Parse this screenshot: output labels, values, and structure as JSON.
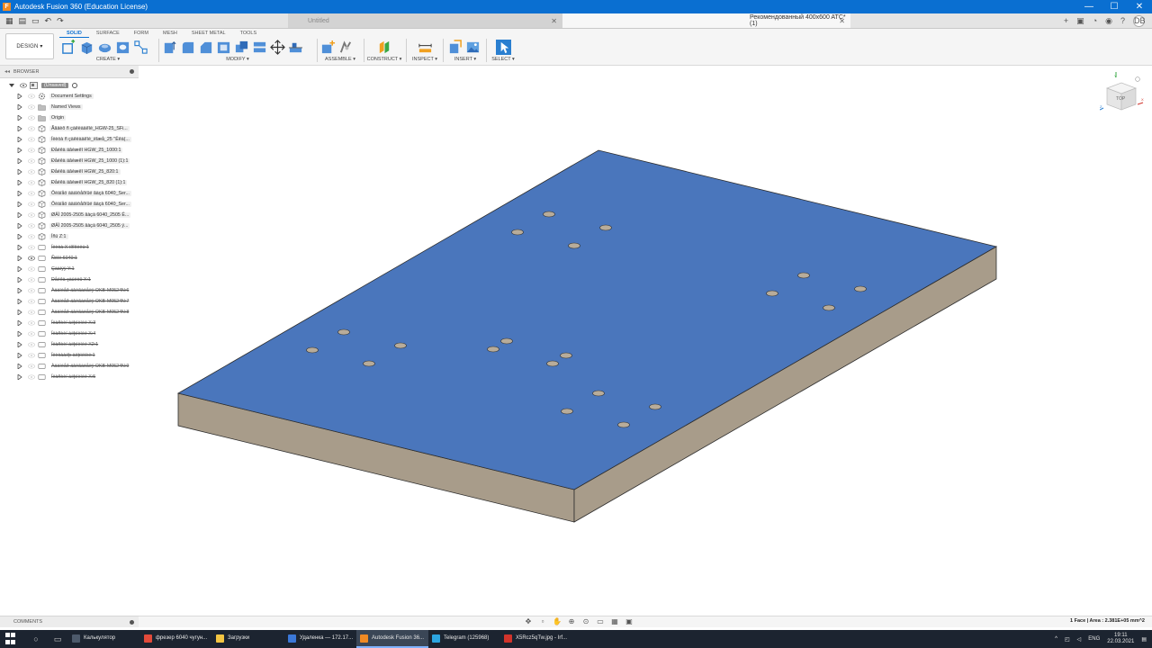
{
  "window": {
    "title": "Autodesk Fusion 360 (Education License)",
    "controls": [
      "—",
      "☐",
      "✕"
    ]
  },
  "tabs": [
    {
      "label": "Untitled",
      "active": false
    },
    {
      "label": "Рекомендованный 400x600 ATC*(1)",
      "active": true
    }
  ],
  "user_initials": "DB",
  "toolbar": {
    "design_label": "DESIGN ▾",
    "workspace_tabs": [
      "SOLID",
      "SURFACE",
      "FORM",
      "MESH",
      "SHEET METAL",
      "TOOLS"
    ],
    "groups": {
      "create": "CREATE ▾",
      "modify": "MODIFY ▾",
      "assemble": "ASSEMBLE ▾",
      "construct": "CONSTRUCT ▾",
      "inspect": "INSPECT ▾",
      "insert": "INSERT ▾",
      "select": "SELECT ▾"
    }
  },
  "browser": {
    "header": "BROWSER",
    "items": [
      {
        "label": "(Unsaved)",
        "kind": "root"
      },
      {
        "label": "Document Settings",
        "kind": "settings"
      },
      {
        "label": "Named Views",
        "kind": "folder"
      },
      {
        "label": "Origin",
        "kind": "folder"
      },
      {
        "label": "Ãâäèô ñ çàêëàäêîé_HGW-25_SFi...",
        "kind": "component"
      },
      {
        "label": "Ïëèòà ñ çàêëàäêîé_ëîæå_25 ''Ëêà(...",
        "kind": "component"
      },
      {
        "label": "Ðåéêà äâèæêî HGW_25_1000:1",
        "kind": "component"
      },
      {
        "label": "Ðåéêà äâèæêî HGW_25_1000 (1):1",
        "kind": "component"
      },
      {
        "label": "Ðåéêà äâèæêî HGW_25_820:1",
        "kind": "component"
      },
      {
        "label": "Ðåéêà äâèæêî HGW_25_820 (1):1",
        "kind": "component"
      },
      {
        "label": "Ôëàíåö àäàïòåðíûé âàçà 6040_Ser...",
        "kind": "component"
      },
      {
        "label": "Ôëàíåö àäàïòåðíûé âàçà 6040_Ser...",
        "kind": "component"
      },
      {
        "label": "ØÂÏ 2005-2505 âàçà 6040_2505 Ê...",
        "kind": "component"
      },
      {
        "label": "ØÂÏ 2005-2505 âàçà 6040_2505 ÿ...",
        "kind": "component"
      },
      {
        "label": "Îñü Z:1",
        "kind": "component"
      },
      {
        "label": "Ïëèòà X ïðîôèëü:1",
        "kind": "body",
        "struck": true
      },
      {
        "label": "Ñòîë 6040:1",
        "kind": "body",
        "struck": true,
        "eye": true
      },
      {
        "label": "Çàäíÿÿ Y:1",
        "kind": "body",
        "struck": true
      },
      {
        "label": "Ðåéêà çàùèòû X:1",
        "kind": "body",
        "struck": true
      },
      {
        "label": "Àäàïòåð äâèãàòåëÿ OKB-M0524N:6",
        "kind": "body",
        "struck": true
      },
      {
        "label": "Àäàïòåð äâèãàòåëÿ OKB-M0524N:7",
        "kind": "body",
        "struck": true
      },
      {
        "label": "Àäàïòåð äâèãàòåëÿ OKB-M0524N:8",
        "kind": "body",
        "struck": true
      },
      {
        "label": "Ïëàñòèí àëþìèíèé X:3",
        "kind": "body",
        "struck": true
      },
      {
        "label": "Ïëàñòèí àëþìèíèé X:4",
        "kind": "body",
        "struck": true
      },
      {
        "label": "Ïëàñòèí àëþìèíèé X2:1",
        "kind": "body",
        "struck": true
      },
      {
        "label": "Ïëèòààëþ àëþìèíèé:1",
        "kind": "body",
        "struck": true
      },
      {
        "label": "Àäàïòåð äâèãàòåëÿ OKB-M0524N:9",
        "kind": "body",
        "struck": true
      },
      {
        "label": "Ïëàñòèí àëþìèíèé X:5",
        "kind": "body",
        "struck": true
      }
    ]
  },
  "comments_label": "COMMENTS",
  "viewcube": {
    "face": "TOP"
  },
  "status": "1 Face | Area : 2.381E+05 mm^2",
  "colors": {
    "top_face": "#4a76bc",
    "side_face": "#a89c8a",
    "hole": "#b8ac9a",
    "accent": "#0a6fd1"
  },
  "taskbar": {
    "tasks": [
      {
        "label": "Калькулятор",
        "color": "#4d5a6b"
      },
      {
        "label": "фрезер 6040 чугун...",
        "color": "#e24a3a"
      },
      {
        "label": "Загрузки",
        "color": "#f4c542"
      },
      {
        "label": "Удаленка — 172.17...",
        "color": "#3b78d8"
      },
      {
        "label": "Autodesk Fusion 36...",
        "color": "#f08a24",
        "active": true
      },
      {
        "label": "Telegram (125968)",
        "color": "#2ca5e0"
      },
      {
        "label": "X5Rcz5qTw.jpg - Irf...",
        "color": "#d2342b"
      }
    ],
    "lang": "ENG",
    "time": "19:11",
    "date": "22.03.2021"
  }
}
